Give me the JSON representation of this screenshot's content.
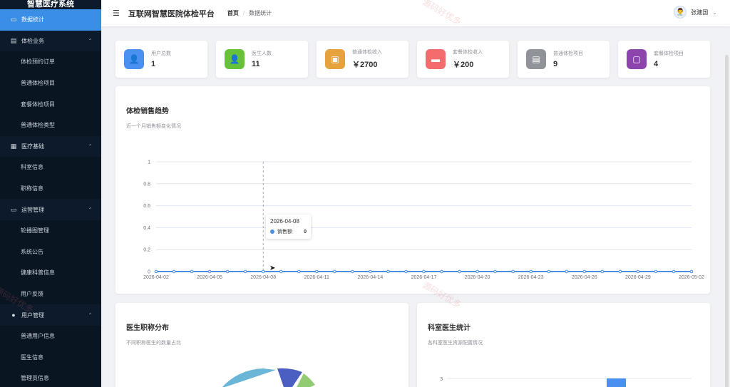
{
  "app": {
    "sidebar_title": "智慧医疗系统",
    "platform_title": "互联网智慧医院体检平台"
  },
  "sidebar": {
    "items": [
      {
        "label": "数据统计",
        "icon": "chart-icon",
        "active": true,
        "type": "item"
      },
      {
        "label": "体检业务",
        "icon": "document-icon",
        "type": "group"
      },
      {
        "label": "体检预约订单",
        "type": "sub"
      },
      {
        "label": "普通体检项目",
        "type": "sub"
      },
      {
        "label": "套餐体检项目",
        "type": "sub"
      },
      {
        "label": "普通体检类型",
        "type": "sub"
      },
      {
        "label": "医疗基础",
        "icon": "grid-icon",
        "type": "group"
      },
      {
        "label": "科室信息",
        "type": "sub"
      },
      {
        "label": "职称信息",
        "type": "sub"
      },
      {
        "label": "运营管理",
        "icon": "monitor-icon",
        "type": "group"
      },
      {
        "label": "轮播图管理",
        "type": "sub"
      },
      {
        "label": "系统公告",
        "type": "sub"
      },
      {
        "label": "健康科普信息",
        "type": "sub"
      },
      {
        "label": "用户反馈",
        "type": "sub"
      },
      {
        "label": "用户管理",
        "icon": "user-icon",
        "type": "group"
      },
      {
        "label": "普通用户信息",
        "type": "sub"
      },
      {
        "label": "医生信息",
        "type": "sub"
      },
      {
        "label": "管理员信息",
        "type": "sub"
      }
    ]
  },
  "header": {
    "breadcrumb_home": "首页",
    "breadcrumb_sep": "/",
    "breadcrumb_current": "数据统计",
    "user_name": "张建国"
  },
  "stats": [
    {
      "label": "用户总数",
      "value": "1",
      "color": "#4a90f0",
      "icon": "user-icon"
    },
    {
      "label": "医生人数",
      "value": "11",
      "color": "#67c23a",
      "icon": "doctor-icon"
    },
    {
      "label": "普通体检收入",
      "value": "￥2700",
      "color": "#e6a23c",
      "icon": "wallet-icon"
    },
    {
      "label": "套餐体检收入",
      "value": "￥200",
      "color": "#f56c6c",
      "icon": "card-icon"
    },
    {
      "label": "普通体检项目",
      "value": "9",
      "color": "#909399",
      "icon": "clipboard-icon"
    },
    {
      "label": "套餐体检项目",
      "value": "4",
      "color": "#8e44ad",
      "icon": "box-icon"
    }
  ],
  "trend_panel": {
    "title": "体检销售趋势",
    "subtitle": "近一个月销售额变化情况"
  },
  "tooltip": {
    "date": "2026-04-08",
    "series": "销售额",
    "value": "0"
  },
  "pie_panel": {
    "title": "医生职称分布",
    "subtitle": "不同职称医生的数量占比"
  },
  "bar_panel": {
    "title": "科室医生统计",
    "subtitle": "各科室医生资源配置情况",
    "y_tick": "3"
  },
  "watermarks": [
    "源码好优多",
    "源码好优多",
    "源码好优多"
  ],
  "chart_data": {
    "type": "line",
    "title": "体检销售趋势",
    "series": [
      {
        "name": "销售额",
        "color": "#4a90e2",
        "values": [
          0,
          0,
          0,
          0,
          0,
          0,
          0,
          0,
          0,
          0,
          0,
          0,
          0,
          0,
          0,
          0,
          0,
          0,
          0,
          0,
          0,
          0,
          0,
          0,
          0,
          0,
          0,
          0,
          0,
          0,
          0
        ]
      }
    ],
    "x": [
      "2026-04-02",
      "2026-04-03",
      "2026-04-04",
      "2026-04-05",
      "2026-04-06",
      "2026-04-07",
      "2026-04-08",
      "2026-04-09",
      "2026-04-10",
      "2026-04-11",
      "2026-04-12",
      "2026-04-13",
      "2026-04-14",
      "2026-04-15",
      "2026-04-16",
      "2026-04-17",
      "2026-04-18",
      "2026-04-19",
      "2026-04-20",
      "2026-04-21",
      "2026-04-22",
      "2026-04-23",
      "2026-04-24",
      "2026-04-25",
      "2026-04-26",
      "2026-04-27",
      "2026-04-28",
      "2026-04-29",
      "2026-04-30",
      "2026-05-01",
      "2026-05-02"
    ],
    "x_tick_labels": [
      "2026-04-02",
      "2026-04-05",
      "2026-04-08",
      "2026-04-11",
      "2026-04-14",
      "2026-04-17",
      "2026-04-20",
      "2026-04-23",
      "2026-04-26",
      "2026-04-29",
      "2026-05-02"
    ],
    "y_ticks": [
      "0",
      "0.2",
      "0.4",
      "0.6",
      "0.8",
      "1"
    ],
    "ylim": [
      0,
      1
    ],
    "grid": true
  }
}
